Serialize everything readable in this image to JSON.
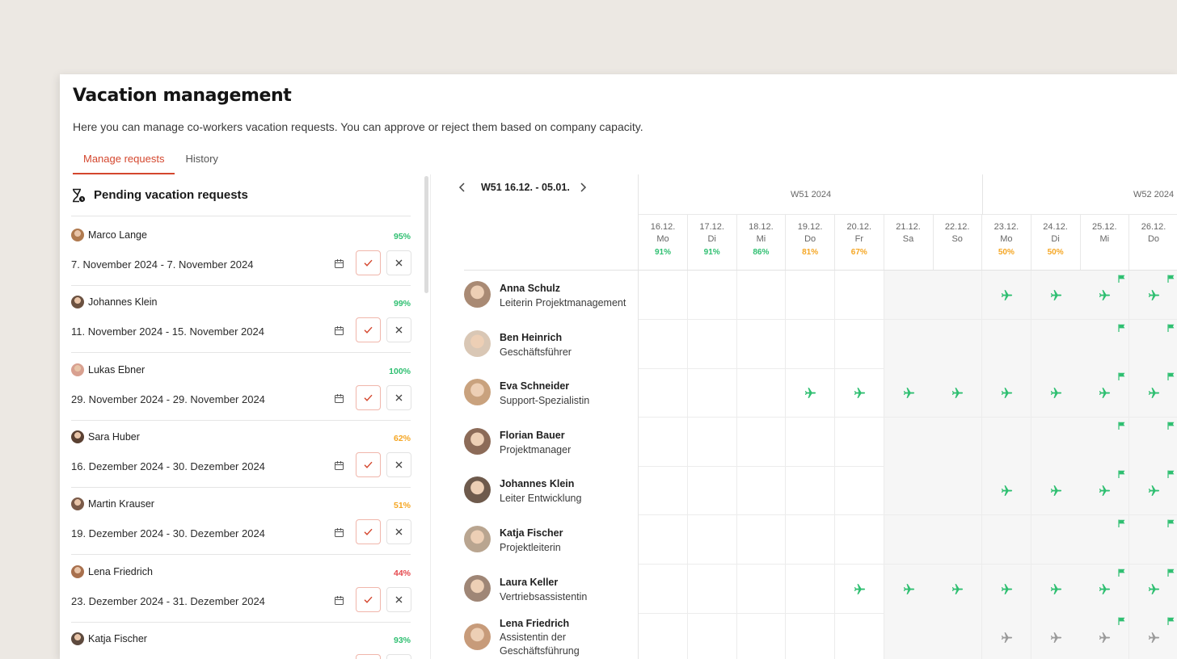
{
  "page": {
    "title": "Vacation management",
    "subtitle": "Here you can manage co-workers vacation requests. You can approve or reject them based on company capacity."
  },
  "tabs": [
    {
      "label": "Manage requests",
      "active": true
    },
    {
      "label": "History",
      "active": false
    }
  ],
  "pending": {
    "title": "Pending vacation requests",
    "icon": "hourglass-clock-icon",
    "requests": [
      {
        "name": "Marco Lange",
        "percent": "95%",
        "dates": "7. November 2024 - 7. November 2024",
        "pct_color": "#2fbf71"
      },
      {
        "name": "Johannes Klein",
        "percent": "99%",
        "dates": "11. November 2024 - 15. November 2024",
        "pct_color": "#2fbf71"
      },
      {
        "name": "Lukas Ebner",
        "percent": "100%",
        "dates": "29. November 2024 - 29. November 2024",
        "pct_color": "#2fbf71"
      },
      {
        "name": "Sara Huber",
        "percent": "62%",
        "dates": "16. Dezember 2024 - 30. Dezember 2024",
        "pct_color": "#f5a623"
      },
      {
        "name": "Martin Krauser",
        "percent": "51%",
        "dates": "19. Dezember 2024 - 30. Dezember 2024",
        "pct_color": "#f5a623"
      },
      {
        "name": "Lena Friedrich",
        "percent": "44%",
        "dates": "23. Dezember 2024 - 31. Dezember 2024",
        "pct_color": "#e5484d"
      },
      {
        "name": "Katja Fischer",
        "percent": "93%",
        "dates": "",
        "pct_color": "#2fbf71"
      }
    ]
  },
  "calendar": {
    "range": "W51 16.12. - 05.01.",
    "weeks": [
      "W51 2024",
      "W52 2024"
    ],
    "days": [
      {
        "date": "16.12.",
        "wd": "Mo",
        "pct": "91%",
        "color": "#2fbf71",
        "weekend": false
      },
      {
        "date": "17.12.",
        "wd": "Di",
        "pct": "91%",
        "color": "#2fbf71",
        "weekend": false
      },
      {
        "date": "18.12.",
        "wd": "Mi",
        "pct": "86%",
        "color": "#2fbf71",
        "weekend": false
      },
      {
        "date": "19.12.",
        "wd": "Do",
        "pct": "81%",
        "color": "#f5a623",
        "weekend": false
      },
      {
        "date": "20.12.",
        "wd": "Fr",
        "pct": "67%",
        "color": "#f5a623",
        "weekend": false
      },
      {
        "date": "21.12.",
        "wd": "Sa",
        "pct": "",
        "color": "",
        "weekend": true
      },
      {
        "date": "22.12.",
        "wd": "So",
        "pct": "",
        "color": "",
        "weekend": true
      },
      {
        "date": "23.12.",
        "wd": "Mo",
        "pct": "50%",
        "color": "#f5a623",
        "weekend": true
      },
      {
        "date": "24.12.",
        "wd": "Di",
        "pct": "50%",
        "color": "#f5a623",
        "weekend": true
      },
      {
        "date": "25.12.",
        "wd": "Mi",
        "pct": "",
        "color": "",
        "weekend": true
      },
      {
        "date": "26.12.",
        "wd": "Do",
        "pct": "",
        "color": "",
        "weekend": true
      }
    ],
    "holidays": [
      9,
      10
    ],
    "employees": [
      {
        "name": "Anna Schulz",
        "role": "Leiterin Projektmanagement",
        "vacation": [
          7,
          8,
          9,
          10
        ],
        "pending": false
      },
      {
        "name": "Ben Heinrich",
        "role": "Geschäftsführer",
        "vacation": [],
        "pending": false
      },
      {
        "name": "Eva Schneider",
        "role": "Support-Spezialistin",
        "vacation": [
          3,
          4,
          5,
          6,
          7,
          8,
          9,
          10
        ],
        "pending": false
      },
      {
        "name": "Florian Bauer",
        "role": "Projektmanager",
        "vacation": [],
        "pending": false
      },
      {
        "name": "Johannes Klein",
        "role": "Leiter Entwicklung",
        "vacation": [
          7,
          8,
          9,
          10
        ],
        "pending": false
      },
      {
        "name": "Katja Fischer",
        "role": "Projektleiterin",
        "vacation": [],
        "pending": false
      },
      {
        "name": "Laura Keller",
        "role": "Vertriebsassistentin",
        "vacation": [
          4,
          5,
          6,
          7,
          8,
          9,
          10
        ],
        "pending": false
      },
      {
        "name": "Lena Friedrich",
        "role": "Assistentin der Geschäftsführung",
        "vacation": [
          7,
          8,
          9,
          10
        ],
        "pending": true
      }
    ]
  },
  "colors": {
    "accent": "#d4472e",
    "green": "#2fbf71",
    "orange": "#f5a623",
    "red": "#e5484d",
    "gray_plane": "#9a9a9a"
  }
}
